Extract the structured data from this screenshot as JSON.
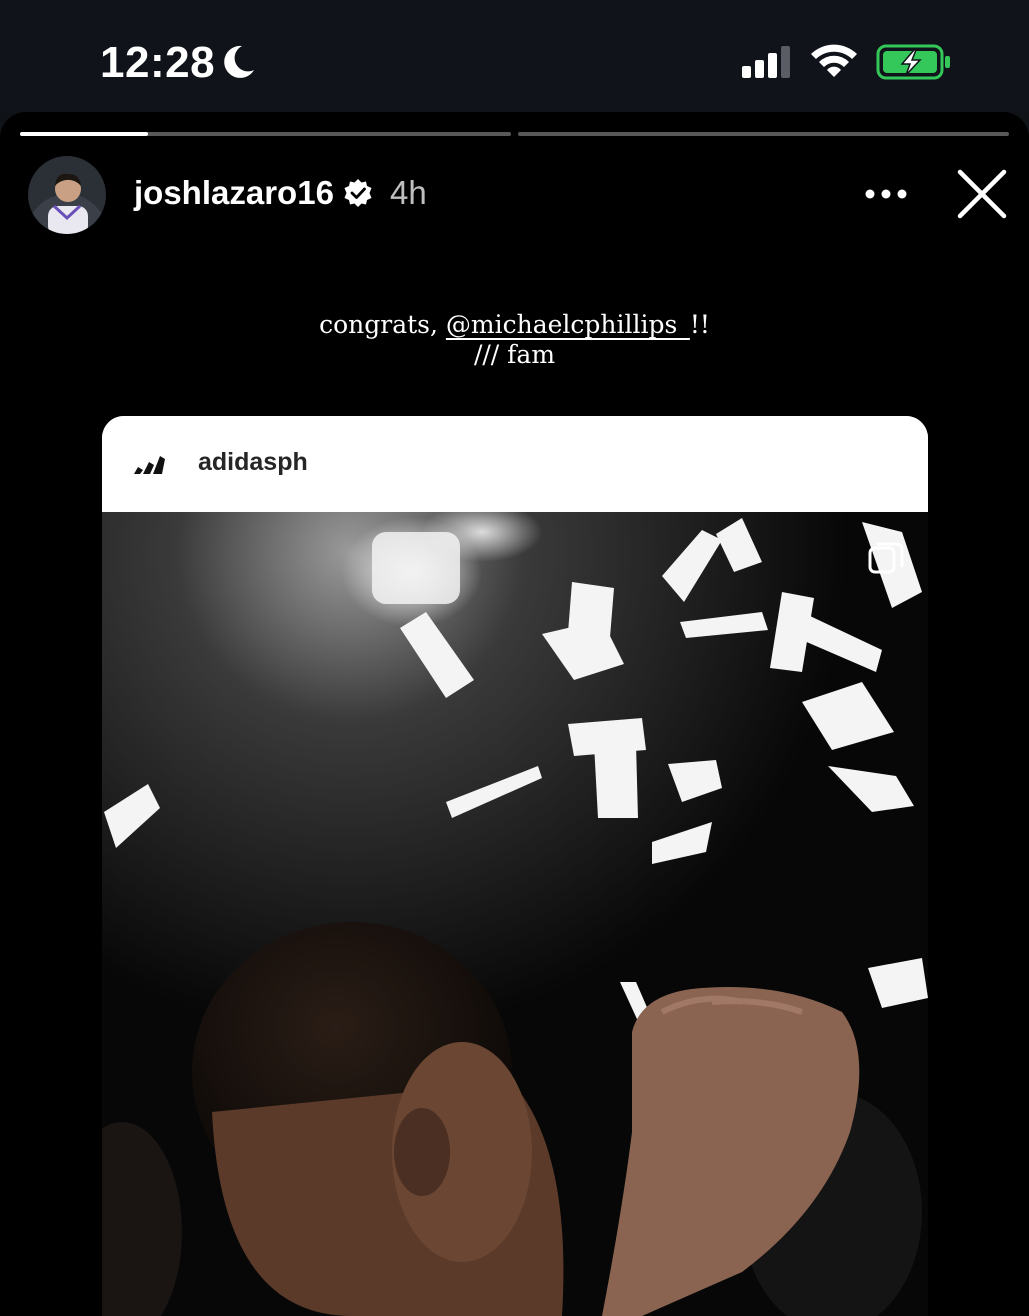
{
  "status_bar": {
    "time": "12:28",
    "moon_icon": "moon-icon",
    "signal_icon": "cellular-signal-icon",
    "wifi_icon": "wifi-icon",
    "battery_icon": "battery-charging-icon",
    "battery_color": "#34c759"
  },
  "story": {
    "progress": [
      0.26,
      0
    ],
    "username": "joshlazaro16",
    "verified_icon": "verified-badge-icon",
    "age": "4h",
    "more_icon": "more-options-icon",
    "close_icon": "close-icon",
    "caption_prefix": "congrats, ",
    "caption_mention": "@michaelcphillips_",
    "caption_suffix": "!!",
    "caption_line2": "/// fam"
  },
  "shared_post": {
    "account": "adidasph",
    "logo_icon": "adidas-logo-icon",
    "carousel_icon": "carousel-icon",
    "photo": "celebration-confetti-photo"
  }
}
